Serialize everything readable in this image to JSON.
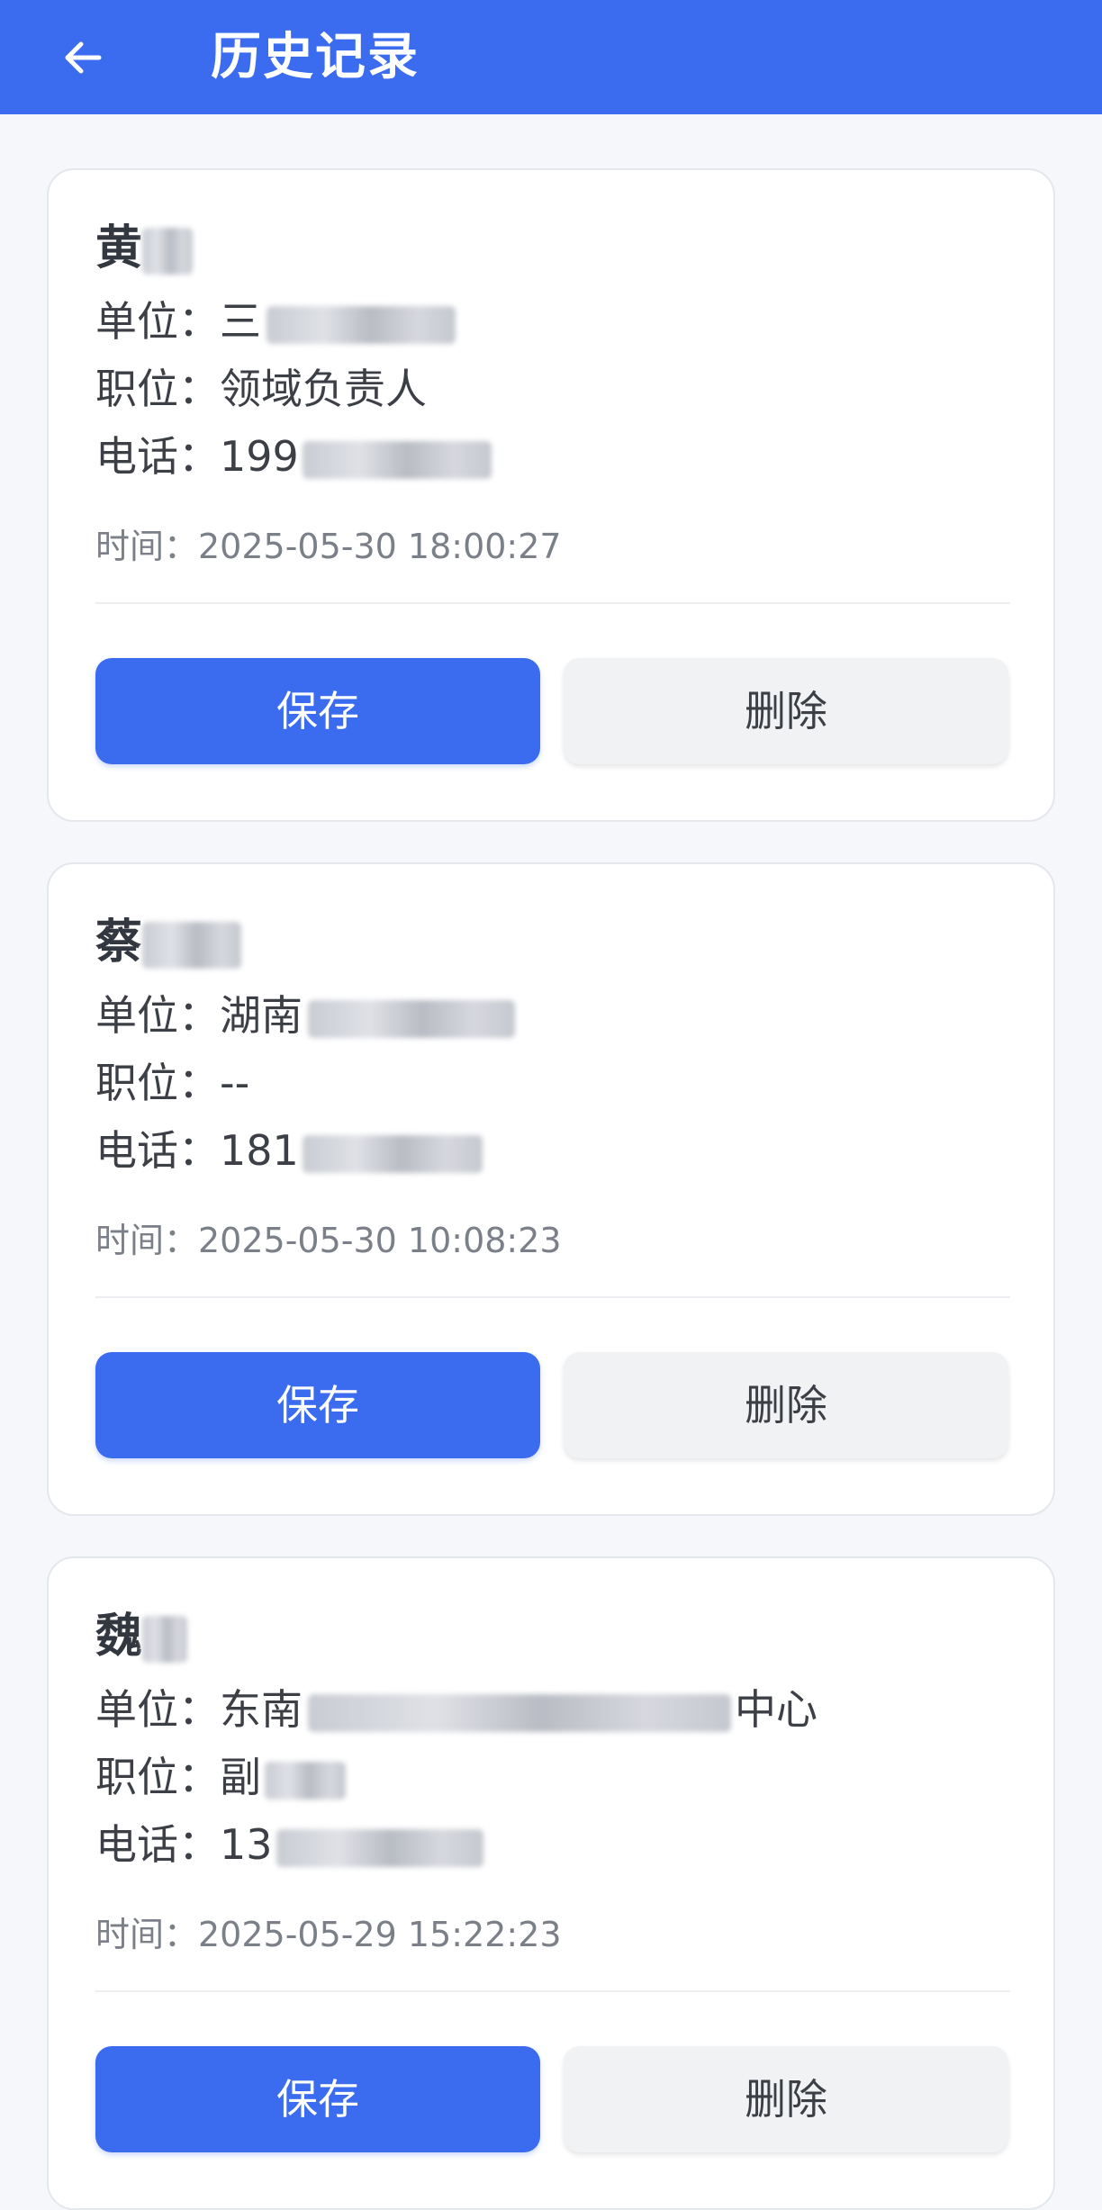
{
  "header": {
    "title": "历史记录",
    "back_icon": "arrow-left-icon",
    "background": "#3b6cf0"
  },
  "records": [
    {
      "name": "黄",
      "unit_label": "单位：",
      "unit_value": "三",
      "position_label": "职位：",
      "position_value": "领域负责人",
      "phone_label": "电话：",
      "phone_value": "199",
      "time": "时间：2025-05-30 18:00:27",
      "save_label": "保存",
      "delete_label": "删除"
    },
    {
      "name": "蔡",
      "unit_label": "单位：",
      "unit_value": "湖南",
      "position_label": "职位：",
      "position_value": "--",
      "phone_label": "电话：",
      "phone_value": "181",
      "time": "时间：2025-05-30 10:08:23",
      "save_label": "保存",
      "delete_label": "删除"
    },
    {
      "name": "魏",
      "unit_label": "单位：",
      "unit_value": "东南",
      "unit_suffix": "中心",
      "position_label": "职位：",
      "position_value": "副",
      "phone_label": "电话：",
      "phone_value": "13",
      "time": "时间：2025-05-29 15:22:23",
      "save_label": "保存",
      "delete_label": "删除"
    }
  ],
  "colors": {
    "primary": "#3b6cf0",
    "delete_bg": "#f1f2f4",
    "page_bg": "#f5f7fa"
  }
}
